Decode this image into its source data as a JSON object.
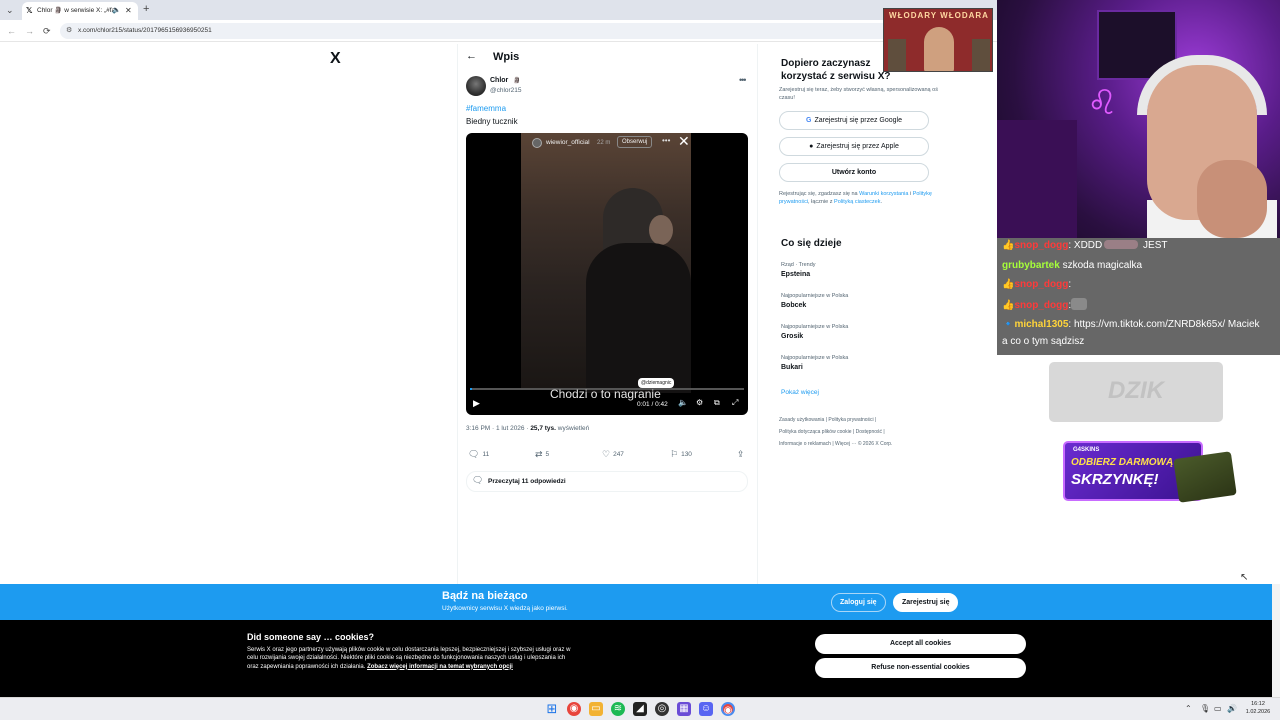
{
  "browser": {
    "tab_title": "Chlor 🗿 w serwisie X: „#fa",
    "url": "x.com/chlor215/status/2017965156936950251",
    "nav_back": "←",
    "nav_forward": "→",
    "nav_reload": "C"
  },
  "x": {
    "logo": "X",
    "header_title": "Wpis",
    "author_name": "Chlor",
    "author_badge": "🗿",
    "author_handle": "@chlor215",
    "hashtag": "#famemma",
    "text": "Biedny tucznik",
    "video": {
      "story_user": "wiewior_official",
      "story_time": "22 m",
      "follow_label": "Obserwuj",
      "sticker": "@dziemagnic",
      "caption": "Chodzi o to nagranie",
      "time": "0:01 / 0:42"
    },
    "timestamp": "3:16 PM · 1 lut 2026 · ",
    "views_count": "25,7 tys.",
    "views_label": " wyświetleń",
    "actions": {
      "replies": "11",
      "reposts": "5",
      "likes": "247",
      "bookmarks": "130"
    },
    "read_replies": "Przeczytaj 11 odpowiedzi"
  },
  "sidebar": {
    "title": "Dopiero zaczynasz korzystać z serwisu X?",
    "desc": "Zarejestruj się teraz, żeby stworzyć własną, spersonalizowaną oś czasu!",
    "google_btn": "Zarejestruj się przez Google",
    "apple_btn": "Zarejestruj się przez Apple",
    "create_btn": "Utwórz konto",
    "terms_prefix": "Rejestrując się, zgadzasz się na ",
    "terms_link1": "Warunki korzystania",
    "terms_mid": " i ",
    "terms_link2": "Politykę prywatności",
    "terms_mid2": ", łącznie z ",
    "terms_link3": "Polityką ciasteczek",
    "terms_end": ".",
    "trends_title": "Co się dzieje",
    "trends": [
      {
        "context": "Rząd · Trendy",
        "name": "Epsteina"
      },
      {
        "context": "Najpopularniejsze w Polska",
        "name": "Bobcek"
      },
      {
        "context": "Najpopularniejsze w Polska",
        "name": "Grosik"
      },
      {
        "context": "Najpopularniejsze w Polska",
        "name": "Bukari"
      }
    ],
    "show_more": "Pokaż więcej",
    "footer1": "Zasady użytkowania  |  Polityka prywatności  |",
    "footer2": "Polityka dotycząca plików cookie  |  Dostępność  |",
    "footer3": "Informacje o reklamach  |  Więcej ···  © 2026 X Corp."
  },
  "bottom_bar": {
    "title": "Bądź na bieżąco",
    "subtitle": "Użytkownicy serwisu X wiedzą jako pierwsi.",
    "login": "Zaloguj się",
    "signup": "Zarejestruj się"
  },
  "cookies": {
    "title": "Did someone say … cookies?",
    "text": "Serwis X oraz jego partnerzy używają plików cookie w celu dostarczania lepszej, bezpieczniejszej i szybszej usługi oraz w celu rozwijania swojej działalności. Niektóre pliki cookie są niezbędne do funkcjonowania naszych usług i ulepszania ich oraz zapewniania poprawności ich działania.",
    "link": "Zobacz więcej informacji na temat wybranych opcji",
    "accept": "Accept all cookies",
    "refuse": "Refuse non-essential cookies"
  },
  "stream": {
    "banner": "WŁODARY WŁODARA",
    "chat": [
      {
        "user": "snop_dogg",
        "color": "#ff3a3a",
        "text": ": XDDD",
        "suffix": " JEST",
        "emote": true
      },
      {
        "user": "grubybartek",
        "color": "#a6ff3a",
        "text": " szkoda magicalka",
        "emote": false
      },
      {
        "user": "snop_dogg",
        "color": "#ff3a3a",
        "text": ":",
        "emote": false
      },
      {
        "user": "snop_dogg",
        "color": "#ff3a3a",
        "text": ":",
        "emote": false
      },
      {
        "user": "michal1305",
        "color": "#ffd43a",
        "text": ": https://vm.tiktok.com/ZNRD8k65x/ Maciek",
        "emote": false
      }
    ],
    "chat_cont": "a co o tym sądzisz",
    "dzik": "DZIK",
    "skins_brand": "G4SKINS",
    "skins_line1": "ODBIERZ DARMOWĄ",
    "skins_line2": "SKRZYNKĘ!"
  },
  "taskbar": {
    "time": "16:12",
    "date": "1.02.2026"
  }
}
